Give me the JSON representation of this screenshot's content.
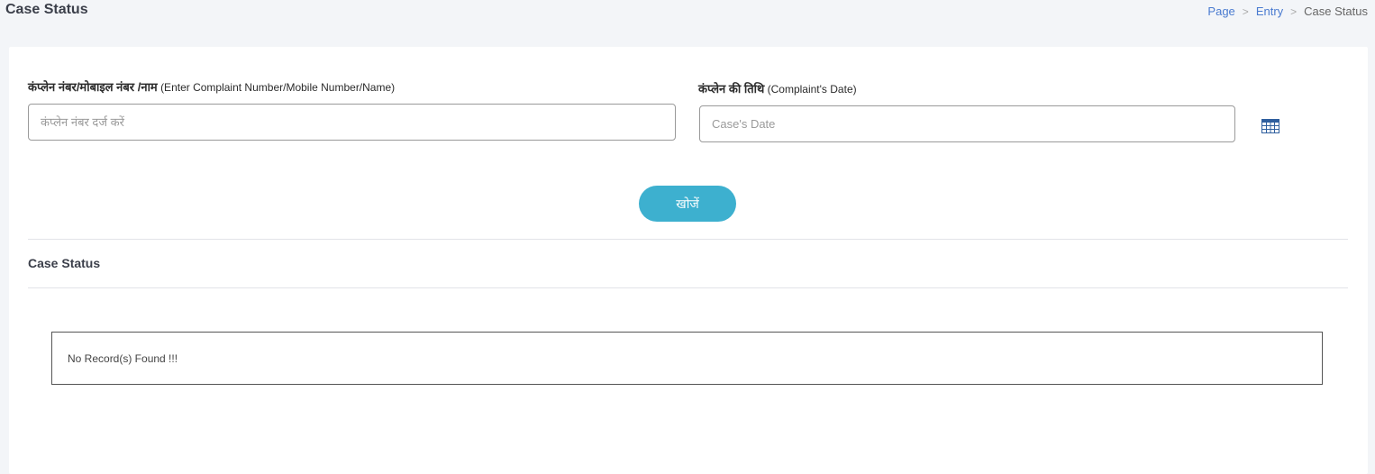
{
  "header": {
    "title": "Case Status",
    "breadcrumb": {
      "items": [
        "Page",
        "Entry"
      ],
      "current": "Case Status",
      "separator": ">"
    }
  },
  "form": {
    "complaint": {
      "label_hi": "कंप्लेन नंबर/मोबाइल नंबर /नाम",
      "label_en": "(Enter Complaint Number/Mobile Number/Name)",
      "placeholder": "कंप्लेन नंबर दर्ज करें",
      "value": ""
    },
    "date": {
      "label_hi": "कंप्लेन की तिथि",
      "label_en": "(Complaint's Date)",
      "placeholder": "Case's Date",
      "value": "",
      "icon": "calendar-icon"
    },
    "search_button_label": "खोजें"
  },
  "results": {
    "section_title": "Case Status",
    "empty_message": "No Record(s) Found !!!"
  },
  "colors": {
    "accent": "#3db0cf",
    "link": "#4a7bd0",
    "background": "#f3f5f8"
  }
}
